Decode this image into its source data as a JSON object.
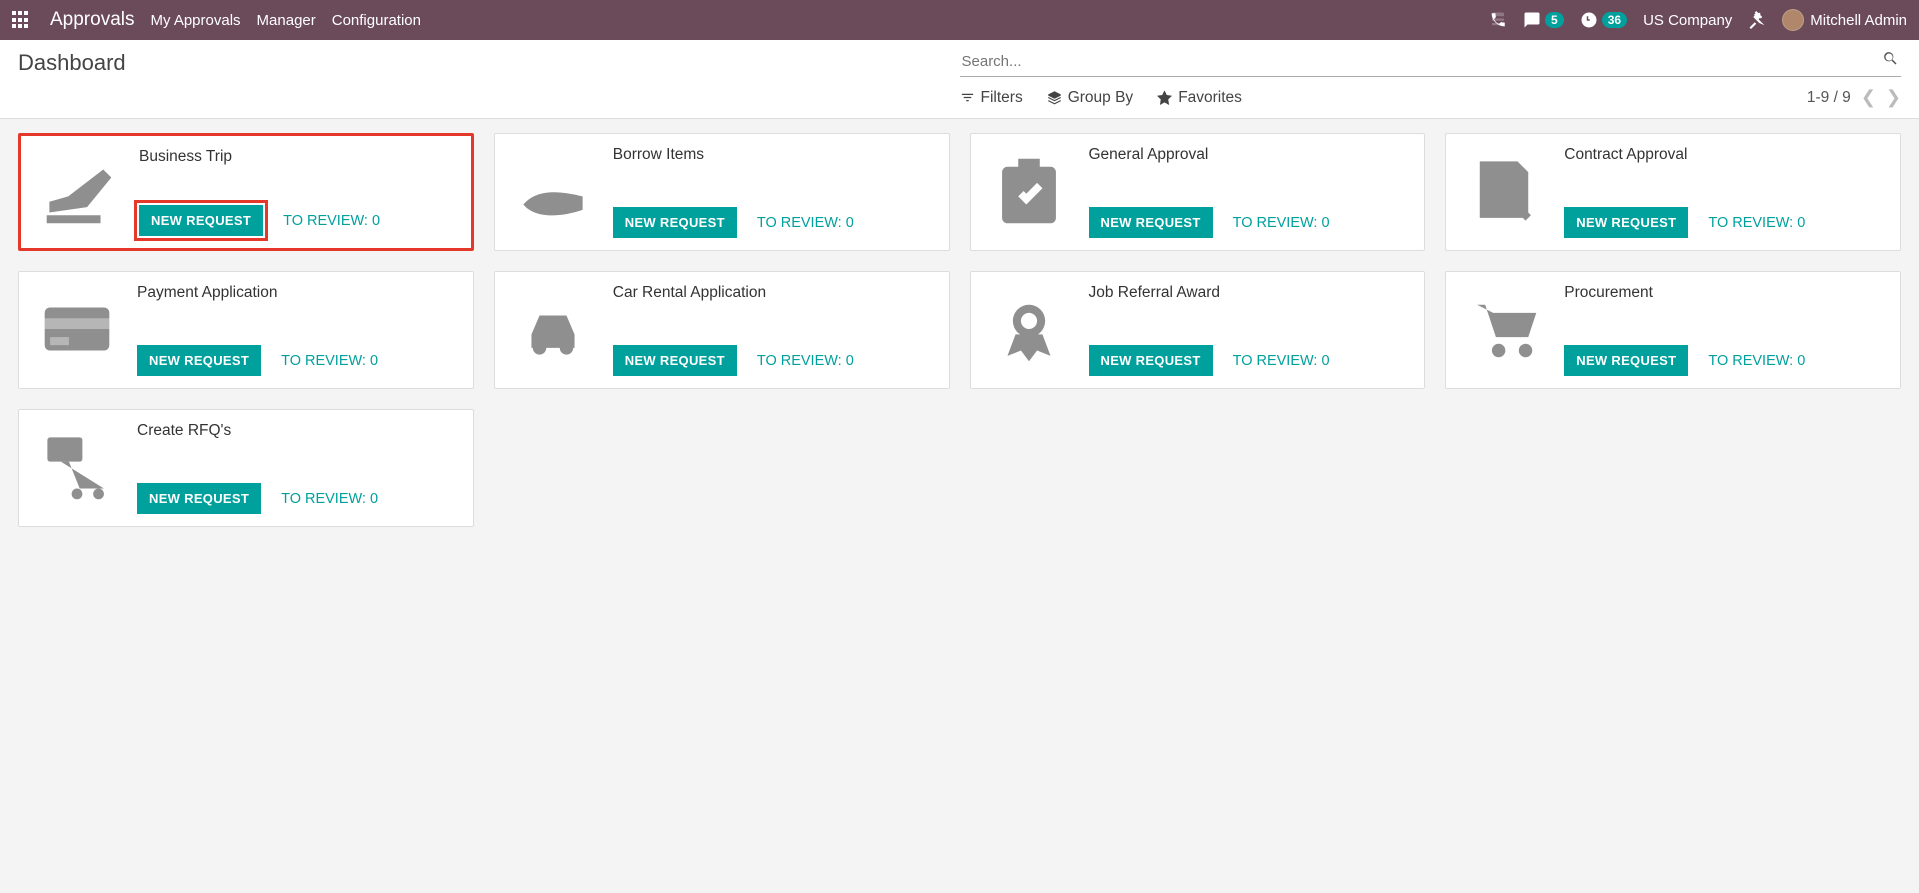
{
  "nav": {
    "app_name": "Approvals",
    "menu": [
      "My Approvals",
      "Manager",
      "Configuration"
    ],
    "messages_badge": "5",
    "activities_badge": "36",
    "company": "US Company",
    "user_name": "Mitchell Admin"
  },
  "breadcrumb": {
    "title": "Dashboard"
  },
  "search": {
    "placeholder": "Search..."
  },
  "filters": {
    "filters_label": "Filters",
    "group_by_label": "Group By",
    "favorites_label": "Favorites"
  },
  "pager": {
    "range": "1-9 / 9"
  },
  "card_common": {
    "new_request_label": "NEW REQUEST",
    "to_review_prefix": "TO REVIEW:"
  },
  "cards": [
    {
      "title": "Business Trip",
      "to_review": 0,
      "icon": "plane",
      "highlight": true
    },
    {
      "title": "Borrow Items",
      "to_review": 0,
      "icon": "hand",
      "highlight": false
    },
    {
      "title": "General Approval",
      "to_review": 0,
      "icon": "clipboard",
      "highlight": false
    },
    {
      "title": "Contract Approval",
      "to_review": 0,
      "icon": "contract",
      "highlight": false
    },
    {
      "title": "Payment Application",
      "to_review": 0,
      "icon": "card",
      "highlight": false
    },
    {
      "title": "Car Rental Application",
      "to_review": 0,
      "icon": "car",
      "highlight": false
    },
    {
      "title": "Job Referral Award",
      "to_review": 0,
      "icon": "award",
      "highlight": false
    },
    {
      "title": "Procurement",
      "to_review": 0,
      "icon": "cart",
      "highlight": false
    },
    {
      "title": "Create RFQ's",
      "to_review": 0,
      "icon": "rfq",
      "highlight": false
    }
  ]
}
